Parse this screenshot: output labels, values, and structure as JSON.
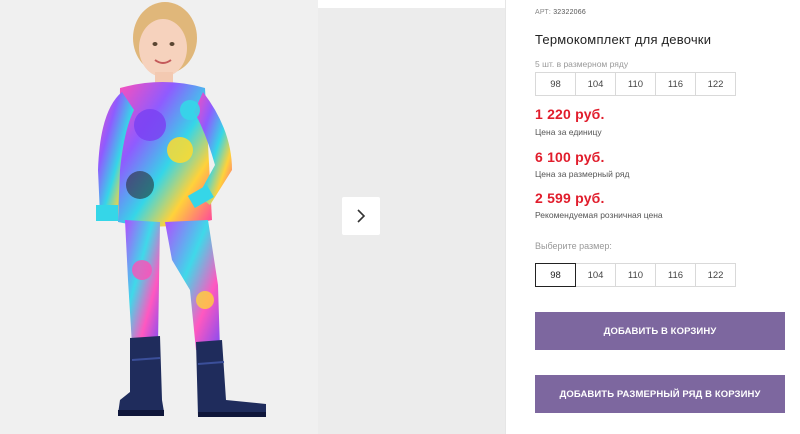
{
  "product": {
    "sku_label": "АРТ:",
    "sku_value": "32322066",
    "title": "Термокомплект для девочки"
  },
  "gallery": {
    "image_alt": "girl-in-graffiti-thermal-suit-photo",
    "next_icon": "chevron-right-icon"
  },
  "size_series": {
    "note": "5 шт. в размерном ряду",
    "sizes": [
      "98",
      "104",
      "110",
      "116",
      "122"
    ]
  },
  "prices": [
    {
      "value": "1 220 руб.",
      "label": "Цена за единицу"
    },
    {
      "value": "6 100 руб.",
      "label": "Цена за размерный ряд"
    },
    {
      "value": "2 599 руб.",
      "label": "Рекомендуемая розничная цена"
    }
  ],
  "size_picker": {
    "label": "Выберите размер:",
    "sizes": [
      "98",
      "104",
      "110",
      "116",
      "122"
    ],
    "selected": "98"
  },
  "buttons": {
    "add_to_cart": "ДОБАВИТЬ В КОРЗИНУ",
    "add_series_to_cart": "ДОБАВИТЬ РАЗМЕРНЫЙ РЯД В КОРЗИНУ"
  },
  "colors": {
    "price": "#e11d2c",
    "button": "#7d679f"
  }
}
